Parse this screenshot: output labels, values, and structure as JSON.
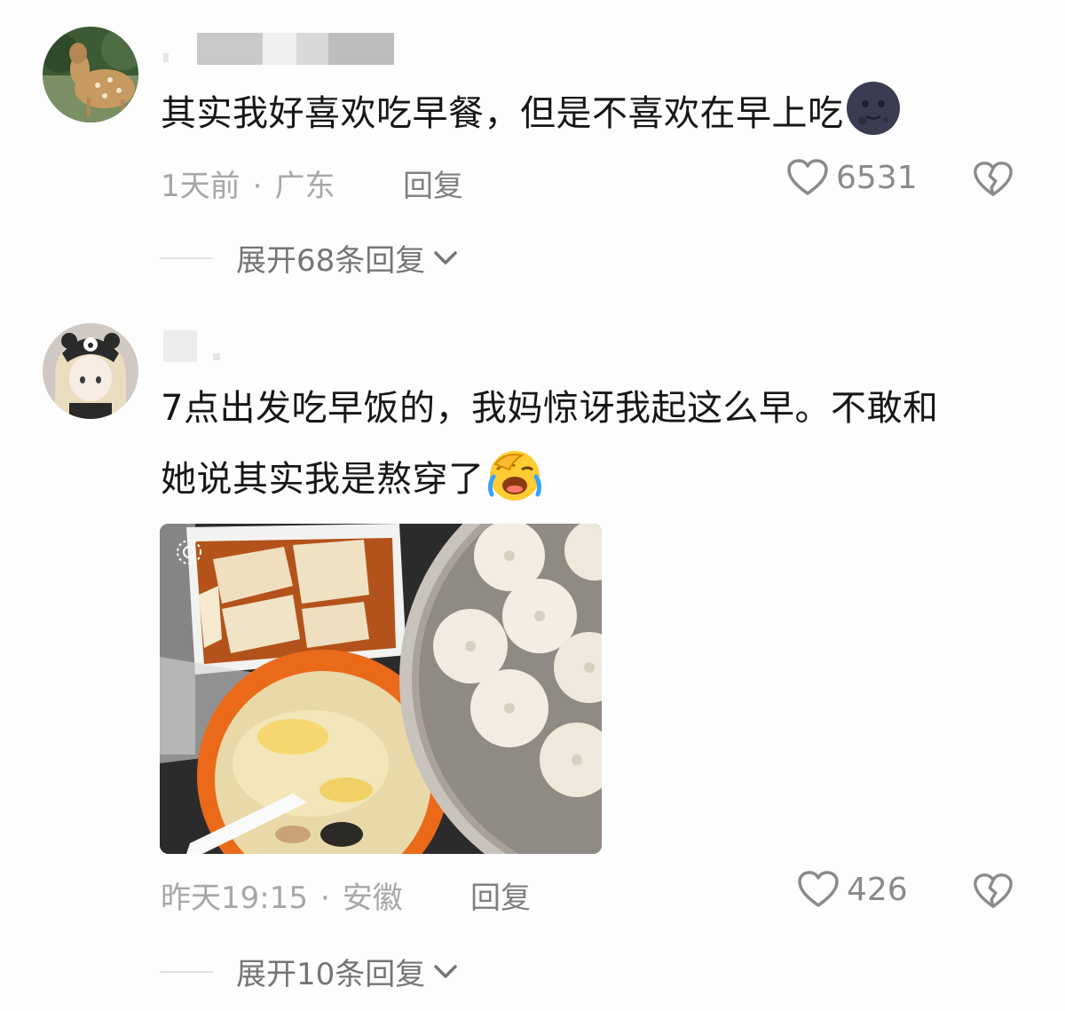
{
  "comments": [
    {
      "text_line1": "其实我好喜欢吃早餐，但是不喜欢在早上吃",
      "emoji": "moon-face-emoji",
      "time": "1天前",
      "location": "广东",
      "reply_label": "回复",
      "likes": "6531",
      "expand_label": "展开68条回复"
    },
    {
      "text_line1": "7点出发吃早饭的，我妈惊讶我起这么早。不敢和",
      "text_line2": "她说其实我是熬穿了",
      "emoji": "laughing-crying-emoji",
      "time": "昨天19:15",
      "location": "安徽",
      "reply_label": "回复",
      "likes": "426",
      "expand_label": "展开10条回复"
    }
  ],
  "separator": "·",
  "colors": {
    "meta": "#a7a7a7",
    "text": "#161616",
    "icon": "#8a8a8a"
  }
}
